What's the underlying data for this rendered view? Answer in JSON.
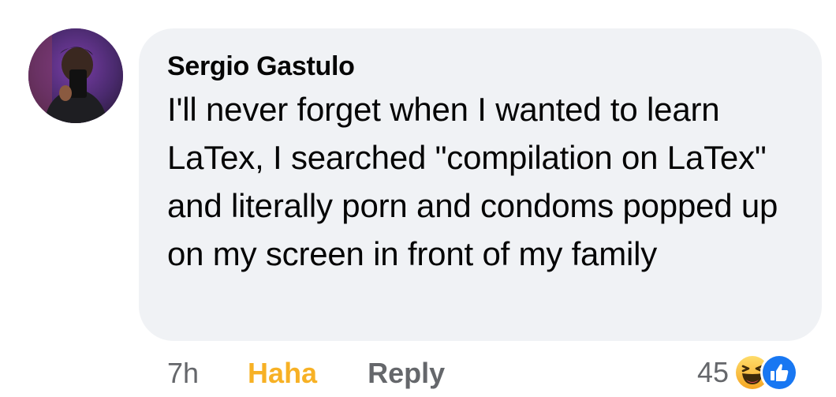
{
  "comment": {
    "author": "Sergio Gastulo",
    "text": "I'll never forget when I wanted to learn LaTex, I searched \"compilation on LaTex\" and literally porn and condoms popped up on my screen in front of my family",
    "time": "7h",
    "reaction_label": "Haha",
    "reply_label": "Reply",
    "reaction_count": "45",
    "reaction_icons": [
      "haha-emoji-icon",
      "like-thumb-icon"
    ]
  },
  "colors": {
    "bubble_background": "#f0f2f5",
    "haha_label": "#f7b125",
    "secondary_text": "#65676b",
    "like_blue": "#1877f2"
  }
}
